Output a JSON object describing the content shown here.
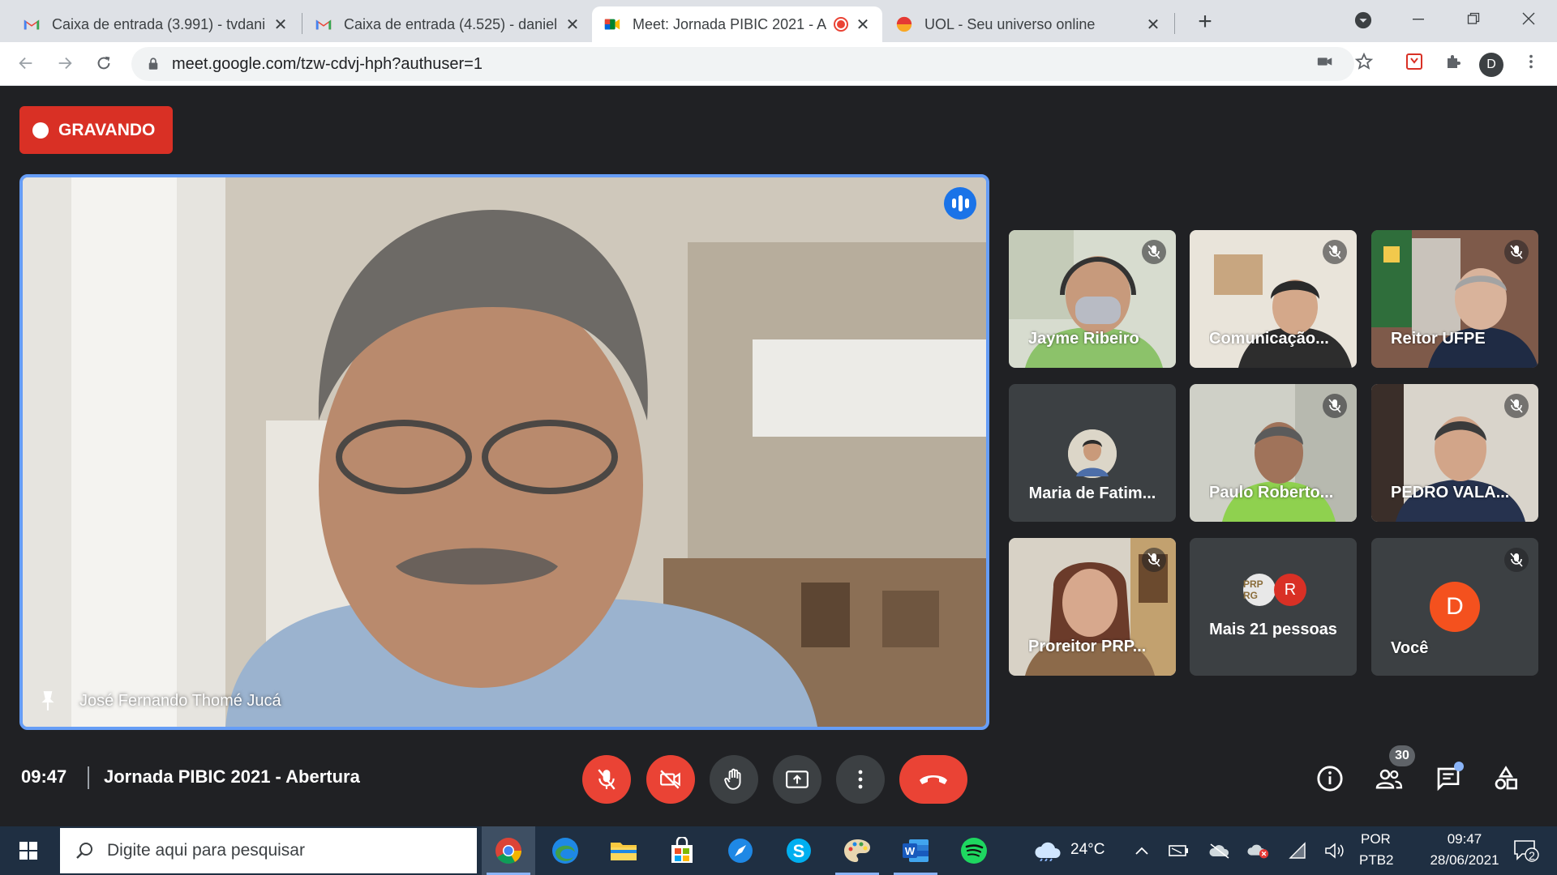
{
  "browser": {
    "tabs": [
      {
        "title": "Caixa de entrada (3.991) - tvdani",
        "icon": "gmail-icon"
      },
      {
        "title": "Caixa de entrada (4.525) - daniel",
        "icon": "gmail-icon"
      },
      {
        "title": "Meet: Jornada PIBIC 2021 - A",
        "icon": "meet-icon",
        "active": true,
        "recording": true
      },
      {
        "title": "UOL - Seu universo online",
        "icon": "uol-icon"
      }
    ],
    "new_tab": "+",
    "url": "meet.google.com/tzw-cdvj-hph?authuser=1",
    "profile_initial": "D"
  },
  "meet": {
    "recording_label": "GRAVANDO",
    "main_speaker": "José Fernando Thomé Jucá",
    "participants": [
      {
        "name": "Jayme Ribeiro",
        "muted": true
      },
      {
        "name": "Comunicação...",
        "muted": true
      },
      {
        "name": "Reitor UFPE",
        "muted": true
      },
      {
        "name": "Maria de Fatim...",
        "muted": false
      },
      {
        "name": "Paulo Roberto...",
        "muted": true
      },
      {
        "name": "PEDRO VALA...",
        "muted": true
      },
      {
        "name": "Proreitor PRP...",
        "muted": true
      },
      {
        "name": "Mais 21 pessoas",
        "muted": false,
        "avatar_initial": "R",
        "avatar_text": "PRP RG"
      },
      {
        "name": "Você",
        "muted": true,
        "avatar_initial": "D"
      }
    ],
    "time": "09:47",
    "meeting_title": "Jornada PIBIC 2021 - Abertura",
    "people_count": "30"
  },
  "taskbar": {
    "search_placeholder": "Digite aqui para pesquisar",
    "weather": "24°C",
    "lang_top": "POR",
    "lang_bottom": "PTB2",
    "clock_time": "09:47",
    "clock_date": "28/06/2021",
    "notifications": "2"
  },
  "colors": {
    "recording_red": "#d93025",
    "speaking_blue": "#669df6",
    "control_red": "#ea4335",
    "meet_bg": "#202124"
  }
}
